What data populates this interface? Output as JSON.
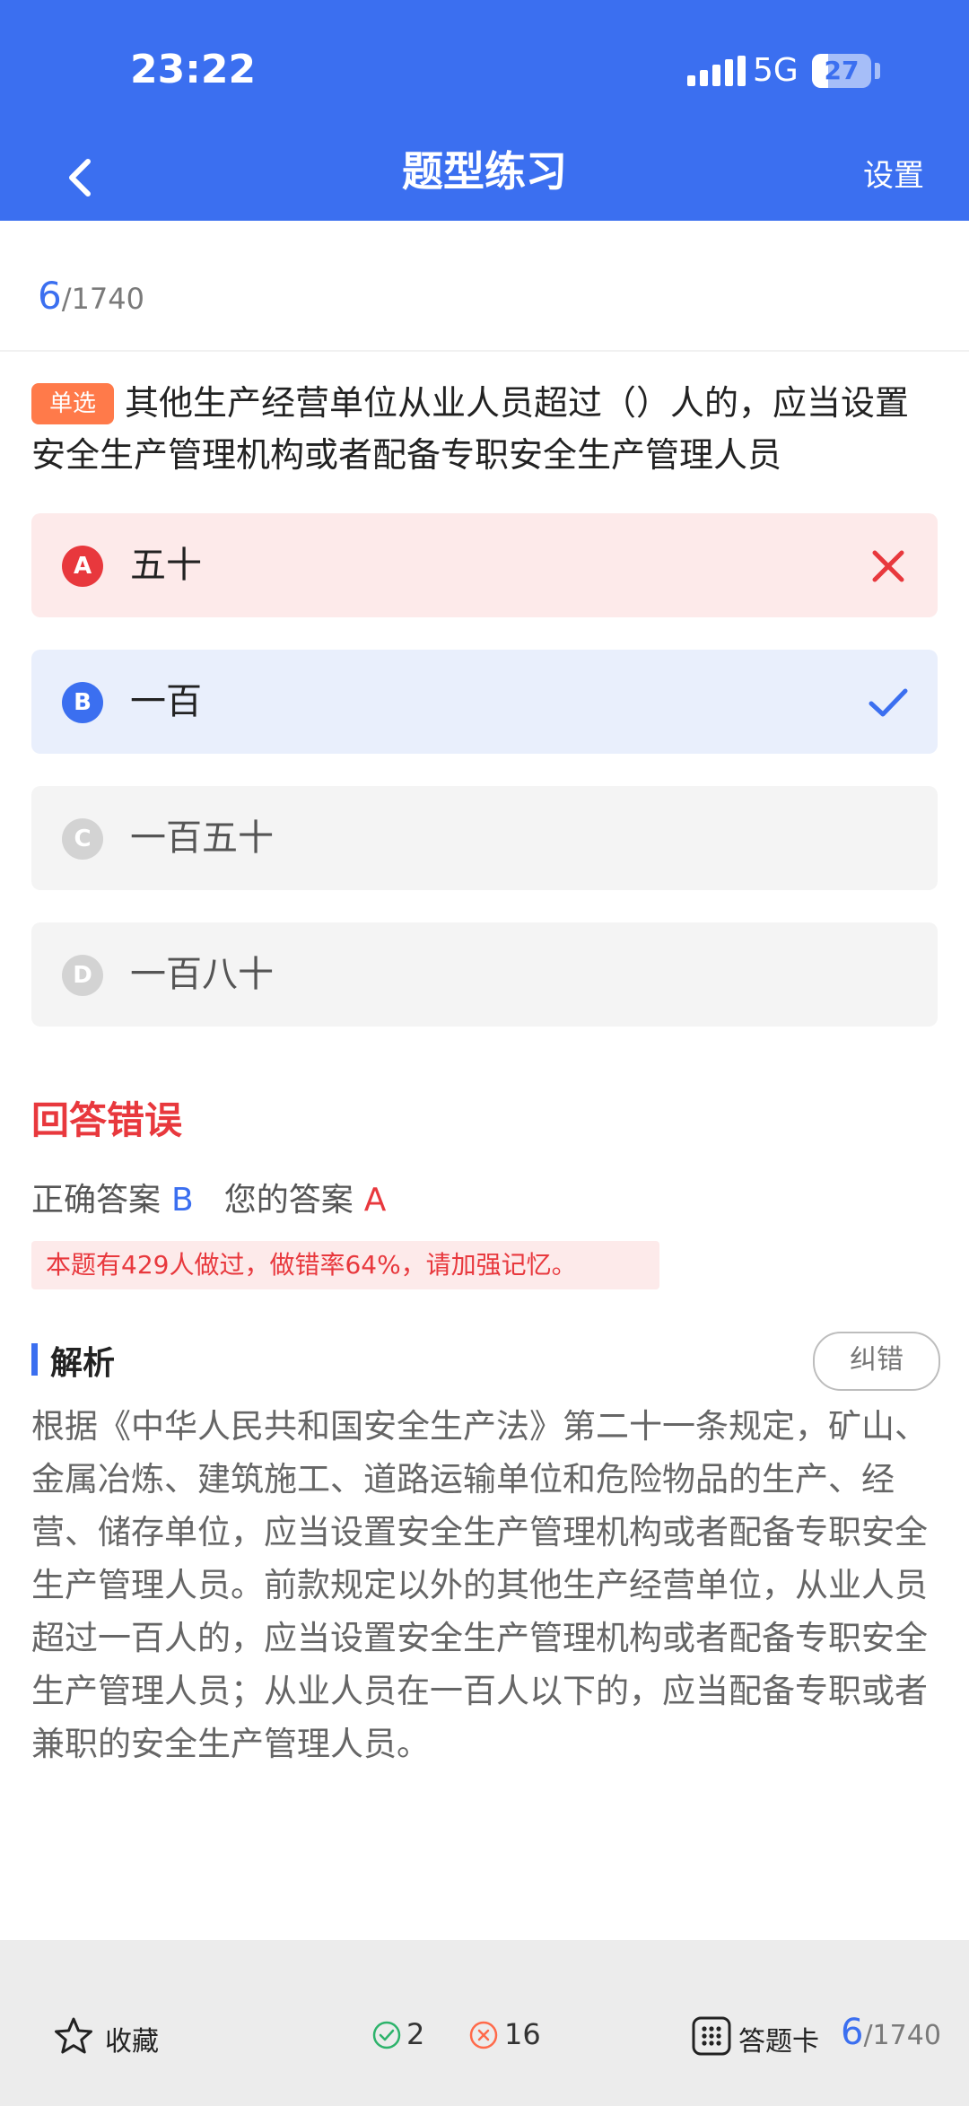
{
  "status": {
    "time": "23:22",
    "network": "5G",
    "battery": "27",
    "battery_level": 0.27
  },
  "nav": {
    "title": "题型练习",
    "settings": "设置",
    "back_icon": "chevron-left-icon"
  },
  "progress": {
    "current": "6",
    "total": "/1740"
  },
  "question": {
    "tag": "单选",
    "text": "其他生产经营单位从业人员超过（）人的，应当设置安全生产管理机构或者配备专职安全生产管理人员"
  },
  "options": [
    {
      "letter": "A",
      "text": "五十",
      "state": "wrong",
      "mark_icon": "close-icon"
    },
    {
      "letter": "B",
      "text": "一百",
      "state": "right",
      "mark_icon": "check-icon"
    },
    {
      "letter": "C",
      "text": "一百五十",
      "state": "none"
    },
    {
      "letter": "D",
      "text": "一百八十",
      "state": "none"
    }
  ],
  "result": {
    "title": "回答错误",
    "correct_label": "正确答案",
    "correct_value": "B",
    "yours_label": "您的答案",
    "yours_value": "A",
    "stat": "本题有429人做过，做错率64%，请加强记忆。"
  },
  "analysis": {
    "title": "解析",
    "report_button": "纠错",
    "text": "根据《中华人民共和国安全生产法》第二十一条规定，矿山、金属冶炼、建筑施工、道路运输单位和危险物品的生产、经营、储存单位，应当设置安全生产管理机构或者配备专职安全生产管理人员。前款规定以外的其他生产经营单位，从业人员超过一百人的，应当设置安全生产管理机构或者配备专职安全生产管理人员；从业人员在一百人以下的，应当配备专职或者兼职的安全生产管理人员。"
  },
  "bottom": {
    "favorite": "收藏",
    "correct_count": "2",
    "wrong_count": "16",
    "answer_card": "答题卡",
    "current": "6",
    "total": "/1740"
  },
  "colors": {
    "primary": "#3b6ff0",
    "error": "#e8383d",
    "tag": "#ff7a4a"
  }
}
